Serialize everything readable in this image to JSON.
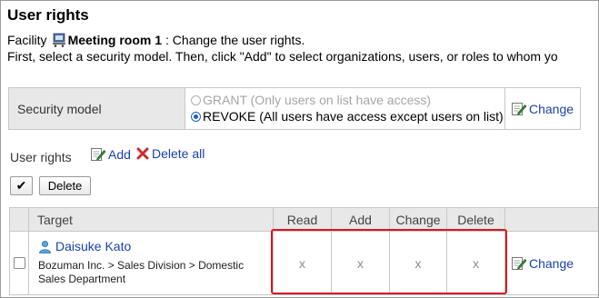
{
  "page": {
    "title": "User rights",
    "facility_label": "Facility",
    "facility_name": "Meeting room 1",
    "facility_suffix": ": Change the user rights.",
    "instructions": "First, select a security model. Then, click \"Add\" to select organizations, users, or roles to whom yo"
  },
  "security_model": {
    "label": "Security model",
    "options": [
      {
        "label": "GRANT (Only users on list have access)",
        "selected": false,
        "disabled": true
      },
      {
        "label": "REVOKE (All users have access except users on list)",
        "selected": true,
        "disabled": false
      }
    ],
    "change_label": "Change"
  },
  "user_rights": {
    "title": "User rights",
    "add_label": "Add",
    "delete_all_label": "Delete all",
    "check_all_symbol": "✔",
    "delete_label": "Delete",
    "columns": [
      "Target",
      "Read",
      "Add",
      "Change",
      "Delete"
    ],
    "rows": [
      {
        "user_name": "Daisuke Kato",
        "org_path": "Bozuman Inc. > Sales Division > Domestic Sales Department",
        "permissions": [
          "x",
          "x",
          "x",
          "x"
        ],
        "change_label": "Change"
      }
    ]
  },
  "colors": {
    "link": "#1a3fae",
    "highlight": "#d71920",
    "header_bg": "#e8e8e8"
  },
  "icons": {
    "facility": "meeting-room-icon",
    "change": "pencil-edit-icon",
    "add": "add-document-icon",
    "delete_all": "red-x-icon",
    "user": "user-icon"
  }
}
